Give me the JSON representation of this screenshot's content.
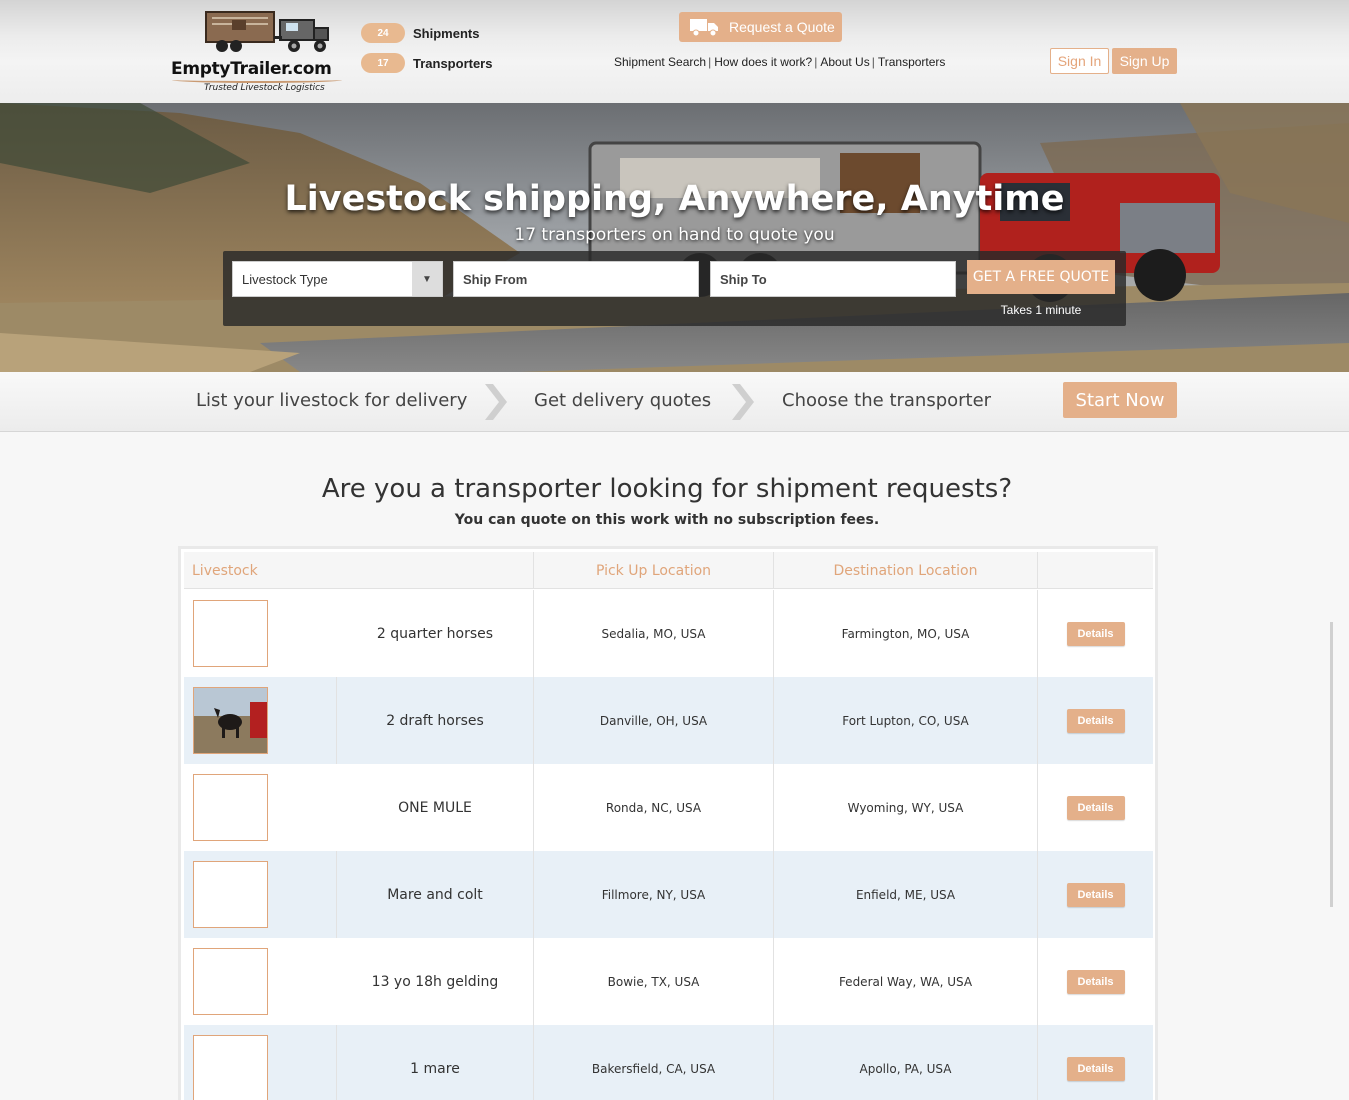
{
  "header": {
    "logo_text": "EmptyTrailer.com",
    "logo_tagline": "Trusted Livestock Logistics",
    "stats": [
      {
        "count": "24",
        "label": "Shipments"
      },
      {
        "count": "17",
        "label": "Transporters"
      }
    ],
    "request_quote": "Request a Quote",
    "nav": [
      "Shipment Search",
      "How does it work?",
      "About Us",
      "Transporters"
    ],
    "sign_in": "Sign In",
    "sign_up": "Sign Up"
  },
  "hero": {
    "title": "Livestock shipping, Anywhere, Anytime",
    "subtitle": "17 transporters on hand to quote you",
    "livestock_type": "Livestock Type",
    "ship_from": "Ship From",
    "ship_to": "Ship To",
    "cta": "GET A FREE QUOTE",
    "takes": "Takes 1 minute"
  },
  "steps": {
    "items": [
      "List your livestock for delivery",
      "Get delivery quotes",
      "Choose the transporter"
    ],
    "start_now": "Start Now"
  },
  "main": {
    "title": "Are you a transporter looking for shipment requests?",
    "subtitle": "You can quote on this work with no subscription fees."
  },
  "table": {
    "headers": [
      "Livestock",
      "Pick Up Location",
      "Destination Location",
      ""
    ],
    "details_label": "Details",
    "rows": [
      {
        "livestock": "2 quarter horses",
        "pickup": "Sedalia, MO, USA",
        "destination": "Farmington, MO, USA"
      },
      {
        "livestock": "2 draft horses",
        "pickup": "Danville, OH, USA",
        "destination": "Fort Lupton, CO, USA"
      },
      {
        "livestock": "ONE MULE",
        "pickup": "Ronda, NC, USA",
        "destination": "Wyoming, WY, USA"
      },
      {
        "livestock": "Mare and colt",
        "pickup": "Fillmore, NY, USA",
        "destination": "Enfield, ME, USA"
      },
      {
        "livestock": "13 yo 18h gelding",
        "pickup": "Bowie, TX, USA",
        "destination": "Federal Way, WA, USA"
      },
      {
        "livestock": "1 mare",
        "pickup": "Bakersfield, CA, USA",
        "destination": "Apollo, PA, USA"
      }
    ]
  },
  "colors": {
    "accent": "#e4b08a",
    "header_text_accent": "#e0a57a",
    "row_alt": "#e8f0f7"
  }
}
